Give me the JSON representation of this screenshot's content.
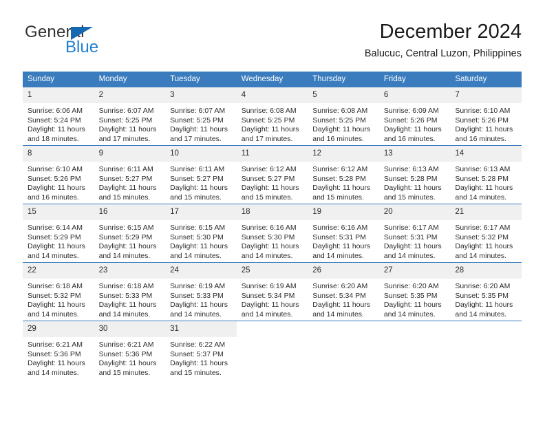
{
  "brand": {
    "name_top": "General",
    "name_bottom": "Blue",
    "triangle_color": "#1567b2",
    "blue_color": "#1f7fd0"
  },
  "header": {
    "title": "December 2024",
    "subtitle": "Balucuc, Central Luzon, Philippines"
  },
  "theme": {
    "header_bg": "#3a7cbe",
    "header_text": "#ffffff",
    "daynum_bg": "#f0f0f0",
    "grid_line": "#3a7cbe",
    "body_text": "#2b2b2b"
  },
  "calendar": {
    "weekday_headers": [
      "Sunday",
      "Monday",
      "Tuesday",
      "Wednesday",
      "Thursday",
      "Friday",
      "Saturday"
    ],
    "weeks": [
      [
        {
          "day": "1",
          "sunrise": "Sunrise: 6:06 AM",
          "sunset": "Sunset: 5:24 PM",
          "daylight1": "Daylight: 11 hours",
          "daylight2": "and 18 minutes."
        },
        {
          "day": "2",
          "sunrise": "Sunrise: 6:07 AM",
          "sunset": "Sunset: 5:25 PM",
          "daylight1": "Daylight: 11 hours",
          "daylight2": "and 17 minutes."
        },
        {
          "day": "3",
          "sunrise": "Sunrise: 6:07 AM",
          "sunset": "Sunset: 5:25 PM",
          "daylight1": "Daylight: 11 hours",
          "daylight2": "and 17 minutes."
        },
        {
          "day": "4",
          "sunrise": "Sunrise: 6:08 AM",
          "sunset": "Sunset: 5:25 PM",
          "daylight1": "Daylight: 11 hours",
          "daylight2": "and 17 minutes."
        },
        {
          "day": "5",
          "sunrise": "Sunrise: 6:08 AM",
          "sunset": "Sunset: 5:25 PM",
          "daylight1": "Daylight: 11 hours",
          "daylight2": "and 16 minutes."
        },
        {
          "day": "6",
          "sunrise": "Sunrise: 6:09 AM",
          "sunset": "Sunset: 5:26 PM",
          "daylight1": "Daylight: 11 hours",
          "daylight2": "and 16 minutes."
        },
        {
          "day": "7",
          "sunrise": "Sunrise: 6:10 AM",
          "sunset": "Sunset: 5:26 PM",
          "daylight1": "Daylight: 11 hours",
          "daylight2": "and 16 minutes."
        }
      ],
      [
        {
          "day": "8",
          "sunrise": "Sunrise: 6:10 AM",
          "sunset": "Sunset: 5:26 PM",
          "daylight1": "Daylight: 11 hours",
          "daylight2": "and 16 minutes."
        },
        {
          "day": "9",
          "sunrise": "Sunrise: 6:11 AM",
          "sunset": "Sunset: 5:27 PM",
          "daylight1": "Daylight: 11 hours",
          "daylight2": "and 15 minutes."
        },
        {
          "day": "10",
          "sunrise": "Sunrise: 6:11 AM",
          "sunset": "Sunset: 5:27 PM",
          "daylight1": "Daylight: 11 hours",
          "daylight2": "and 15 minutes."
        },
        {
          "day": "11",
          "sunrise": "Sunrise: 6:12 AM",
          "sunset": "Sunset: 5:27 PM",
          "daylight1": "Daylight: 11 hours",
          "daylight2": "and 15 minutes."
        },
        {
          "day": "12",
          "sunrise": "Sunrise: 6:12 AM",
          "sunset": "Sunset: 5:28 PM",
          "daylight1": "Daylight: 11 hours",
          "daylight2": "and 15 minutes."
        },
        {
          "day": "13",
          "sunrise": "Sunrise: 6:13 AM",
          "sunset": "Sunset: 5:28 PM",
          "daylight1": "Daylight: 11 hours",
          "daylight2": "and 15 minutes."
        },
        {
          "day": "14",
          "sunrise": "Sunrise: 6:13 AM",
          "sunset": "Sunset: 5:28 PM",
          "daylight1": "Daylight: 11 hours",
          "daylight2": "and 14 minutes."
        }
      ],
      [
        {
          "day": "15",
          "sunrise": "Sunrise: 6:14 AM",
          "sunset": "Sunset: 5:29 PM",
          "daylight1": "Daylight: 11 hours",
          "daylight2": "and 14 minutes."
        },
        {
          "day": "16",
          "sunrise": "Sunrise: 6:15 AM",
          "sunset": "Sunset: 5:29 PM",
          "daylight1": "Daylight: 11 hours",
          "daylight2": "and 14 minutes."
        },
        {
          "day": "17",
          "sunrise": "Sunrise: 6:15 AM",
          "sunset": "Sunset: 5:30 PM",
          "daylight1": "Daylight: 11 hours",
          "daylight2": "and 14 minutes."
        },
        {
          "day": "18",
          "sunrise": "Sunrise: 6:16 AM",
          "sunset": "Sunset: 5:30 PM",
          "daylight1": "Daylight: 11 hours",
          "daylight2": "and 14 minutes."
        },
        {
          "day": "19",
          "sunrise": "Sunrise: 6:16 AM",
          "sunset": "Sunset: 5:31 PM",
          "daylight1": "Daylight: 11 hours",
          "daylight2": "and 14 minutes."
        },
        {
          "day": "20",
          "sunrise": "Sunrise: 6:17 AM",
          "sunset": "Sunset: 5:31 PM",
          "daylight1": "Daylight: 11 hours",
          "daylight2": "and 14 minutes."
        },
        {
          "day": "21",
          "sunrise": "Sunrise: 6:17 AM",
          "sunset": "Sunset: 5:32 PM",
          "daylight1": "Daylight: 11 hours",
          "daylight2": "and 14 minutes."
        }
      ],
      [
        {
          "day": "22",
          "sunrise": "Sunrise: 6:18 AM",
          "sunset": "Sunset: 5:32 PM",
          "daylight1": "Daylight: 11 hours",
          "daylight2": "and 14 minutes."
        },
        {
          "day": "23",
          "sunrise": "Sunrise: 6:18 AM",
          "sunset": "Sunset: 5:33 PM",
          "daylight1": "Daylight: 11 hours",
          "daylight2": "and 14 minutes."
        },
        {
          "day": "24",
          "sunrise": "Sunrise: 6:19 AM",
          "sunset": "Sunset: 5:33 PM",
          "daylight1": "Daylight: 11 hours",
          "daylight2": "and 14 minutes."
        },
        {
          "day": "25",
          "sunrise": "Sunrise: 6:19 AM",
          "sunset": "Sunset: 5:34 PM",
          "daylight1": "Daylight: 11 hours",
          "daylight2": "and 14 minutes."
        },
        {
          "day": "26",
          "sunrise": "Sunrise: 6:20 AM",
          "sunset": "Sunset: 5:34 PM",
          "daylight1": "Daylight: 11 hours",
          "daylight2": "and 14 minutes."
        },
        {
          "day": "27",
          "sunrise": "Sunrise: 6:20 AM",
          "sunset": "Sunset: 5:35 PM",
          "daylight1": "Daylight: 11 hours",
          "daylight2": "and 14 minutes."
        },
        {
          "day": "28",
          "sunrise": "Sunrise: 6:20 AM",
          "sunset": "Sunset: 5:35 PM",
          "daylight1": "Daylight: 11 hours",
          "daylight2": "and 14 minutes."
        }
      ],
      [
        {
          "day": "29",
          "sunrise": "Sunrise: 6:21 AM",
          "sunset": "Sunset: 5:36 PM",
          "daylight1": "Daylight: 11 hours",
          "daylight2": "and 14 minutes."
        },
        {
          "day": "30",
          "sunrise": "Sunrise: 6:21 AM",
          "sunset": "Sunset: 5:36 PM",
          "daylight1": "Daylight: 11 hours",
          "daylight2": "and 15 minutes."
        },
        {
          "day": "31",
          "sunrise": "Sunrise: 6:22 AM",
          "sunset": "Sunset: 5:37 PM",
          "daylight1": "Daylight: 11 hours",
          "daylight2": "and 15 minutes."
        },
        {
          "day": "",
          "sunrise": "",
          "sunset": "",
          "daylight1": "",
          "daylight2": ""
        },
        {
          "day": "",
          "sunrise": "",
          "sunset": "",
          "daylight1": "",
          "daylight2": ""
        },
        {
          "day": "",
          "sunrise": "",
          "sunset": "",
          "daylight1": "",
          "daylight2": ""
        },
        {
          "day": "",
          "sunrise": "",
          "sunset": "",
          "daylight1": "",
          "daylight2": ""
        }
      ]
    ]
  }
}
